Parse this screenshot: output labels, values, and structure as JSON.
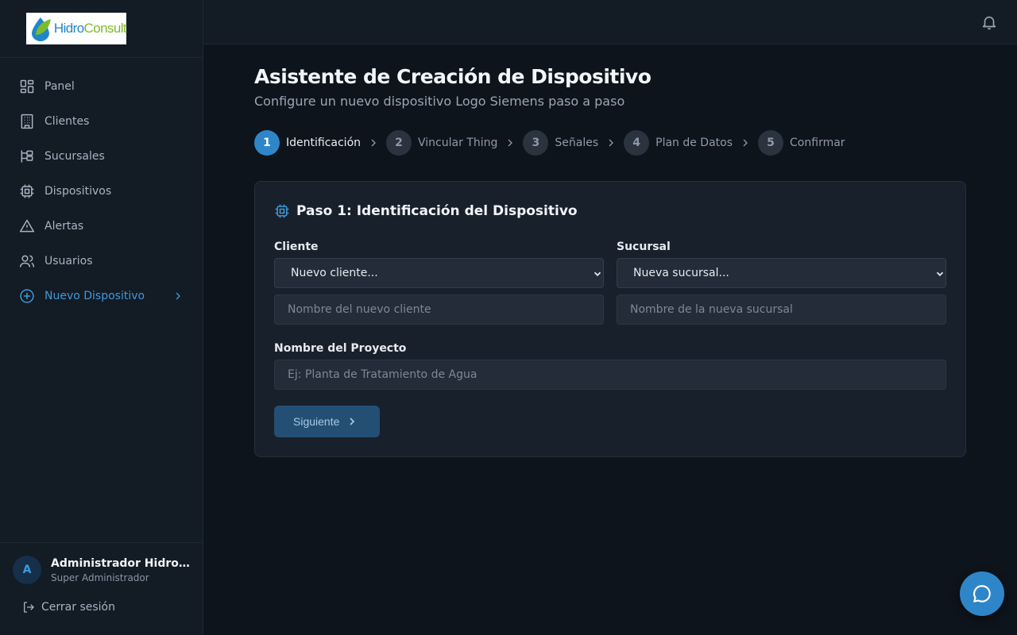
{
  "brand": {
    "logo_part1": "Hidro",
    "logo_part2": "Consult"
  },
  "sidebar": {
    "items": [
      {
        "label": "Panel",
        "icon": "dashboard-icon"
      },
      {
        "label": "Clientes",
        "icon": "building-icon"
      },
      {
        "label": "Sucursales",
        "icon": "branches-icon"
      },
      {
        "label": "Dispositivos",
        "icon": "chip-icon"
      },
      {
        "label": "Alertas",
        "icon": "warning-icon"
      },
      {
        "label": "Usuarios",
        "icon": "users-icon"
      },
      {
        "label": "Nuevo Dispositivo",
        "icon": "plus-circle-icon",
        "active": true
      }
    ]
  },
  "user": {
    "initial": "A",
    "name": "Administrador HidroConsult",
    "role": "Super Administrador",
    "logout_label": "Cerrar sesión"
  },
  "page": {
    "title": "Asistente de Creación de Dispositivo",
    "subtitle": "Configure un nuevo dispositivo Logo Siemens paso a paso"
  },
  "steps": [
    {
      "num": "1",
      "label": "Identificación",
      "active": true
    },
    {
      "num": "2",
      "label": "Vincular Thing"
    },
    {
      "num": "3",
      "label": "Señales"
    },
    {
      "num": "4",
      "label": "Plan de Datos"
    },
    {
      "num": "5",
      "label": "Confirmar"
    }
  ],
  "form": {
    "title": "Paso 1: Identificación del Dispositivo",
    "cliente_label": "Cliente",
    "cliente_selected": "Nuevo cliente...",
    "cliente_placeholder": "Nombre del nuevo cliente",
    "sucursal_label": "Sucursal",
    "sucursal_selected": "Nueva sucursal...",
    "sucursal_placeholder": "Nombre de la nueva sucursal",
    "proyecto_label": "Nombre del Proyecto",
    "proyecto_placeholder": "Ej: Planta de Tratamiento de Agua",
    "next_label": "Siguiente"
  },
  "colors": {
    "accent": "#2e86c9",
    "background": "#0e141c",
    "sidebar": "#131b25",
    "card": "#18202b"
  }
}
